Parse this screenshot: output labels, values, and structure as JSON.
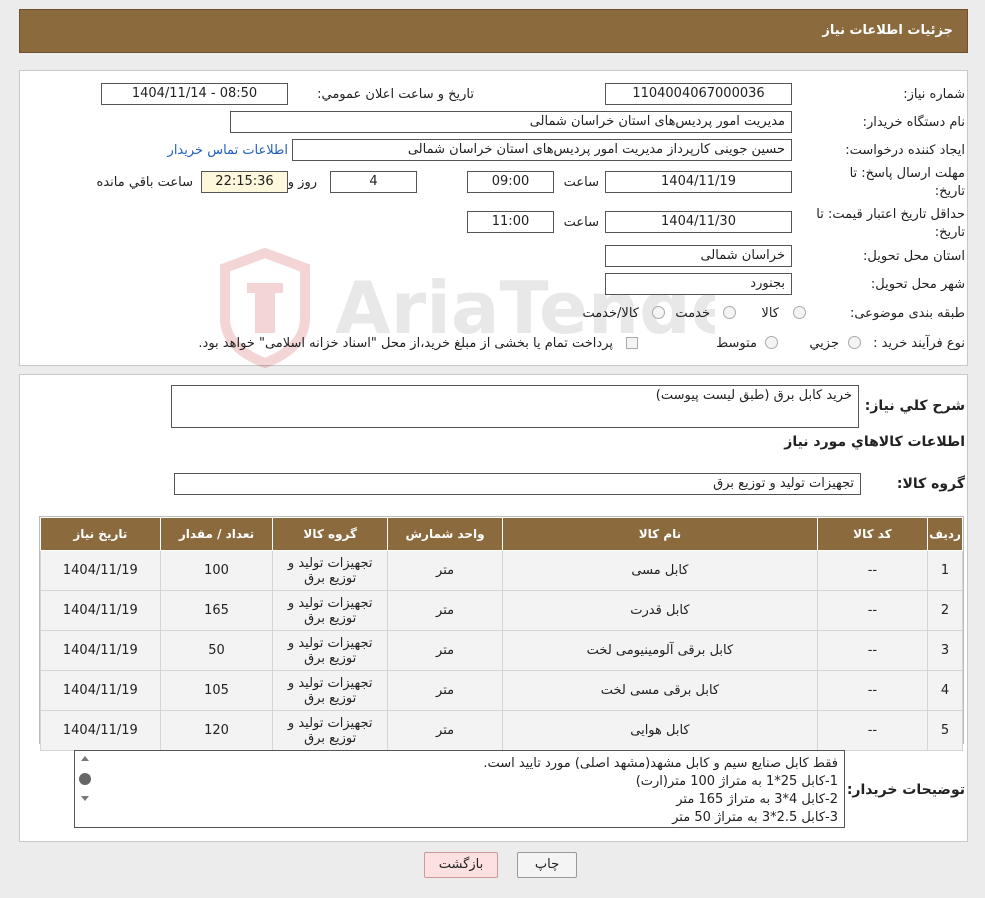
{
  "header": {
    "title": "جزئیات اطلاعات نیاز"
  },
  "form": {
    "need_number_label": "شماره نیاز:",
    "need_number": "1104004067000036",
    "announce_label": "تاریخ و ساعت اعلان عمومي:",
    "announce_value": "1404/11/14 - 08:50",
    "buyer_org_label": "نام دستگاه خریدار:",
    "buyer_org": "مدیریت امور پردیس‌های استان خراسان شمالی",
    "creator_label": "ایجاد کننده درخواست:",
    "creator": "حسین جوینی کارپرداز مدیریت امور پردیس‌های استان خراسان شمالی",
    "contact_link": "اطلاعات تماس خریدار",
    "deadline_label_1": "مهلت ارسال پاسخ: تا",
    "deadline_label_2": "تاریخ:",
    "deadline_date": "1404/11/19",
    "time_label": "ساعت",
    "deadline_time": "09:00",
    "days_value": "4",
    "days_label": "روز و",
    "remaining_time": "22:15:36",
    "remaining_label": "ساعت باقي مانده",
    "validity_label_1": "حداقل تاریخ اعتبار قیمت: تا",
    "validity_label_2": "تاریخ:",
    "validity_date": "1404/11/30",
    "validity_time_label": "ساعت",
    "validity_time": "11:00",
    "province_label": "استان محل تحویل:",
    "province": "خراسان شمالی",
    "city_label": "شهر محل تحویل:",
    "city": "بجنورد",
    "category_label": "طبقه بندی موضوعی:",
    "category_options": [
      "کالا",
      "خدمت",
      "کالا/خدمت"
    ],
    "process_label": "نوع فرآیند خرید :",
    "process_options": [
      "جزيي",
      "متوسط"
    ],
    "payment_note": "پرداخت تمام یا بخشی از مبلغ خرید،از محل \"اسناد خزانه اسلامی\" خواهد بود."
  },
  "details": {
    "summary_label": "شرح کلي نیاز:",
    "summary": "خرید کابل  برق (طبق لیست پیوست)",
    "items_heading": "اطلاعات کالاهاي مورد نیاز",
    "group_label": "گروه کالا:",
    "group_value": "تجهیزات تولید و توزیع برق"
  },
  "table": {
    "headers": [
      "ردیف",
      "کد کالا",
      "نام کالا",
      "واحد شمارش",
      "گروه کالا",
      "تعداد / مقدار",
      "تاریخ نیاز"
    ],
    "rows": [
      [
        "1",
        "--",
        "کابل مسی",
        "متر",
        "تجهیزات تولید و توزیع برق",
        "100",
        "1404/11/19"
      ],
      [
        "2",
        "--",
        "کابل قدرت",
        "متر",
        "تجهیزات تولید و توزیع برق",
        "165",
        "1404/11/19"
      ],
      [
        "3",
        "--",
        "کابل برقی آلومینیومی لخت",
        "متر",
        "تجهیزات تولید و توزیع برق",
        "50",
        "1404/11/19"
      ],
      [
        "4",
        "--",
        "کابل برقی مسی لخت",
        "متر",
        "تجهیزات تولید و توزیع برق",
        "105",
        "1404/11/19"
      ],
      [
        "5",
        "--",
        "کابل هوایی",
        "متر",
        "تجهیزات تولید و توزیع برق",
        "120",
        "1404/11/19"
      ]
    ]
  },
  "buyer_notes": {
    "label": "توضیحات خریدار:",
    "lines": [
      "فقط کابل صنایع سیم و کابل مشهد(مشهد اصلی) مورد تایید است.",
      "1-کابل 25*1  به متراژ 100 متر(ارت)",
      "2-کابل 4*3    به متراژ 165 متر",
      "3-کابل 2.5*3  به متراژ 50 متر"
    ]
  },
  "buttons": {
    "print": "چاپ",
    "back": "بازگشت"
  }
}
